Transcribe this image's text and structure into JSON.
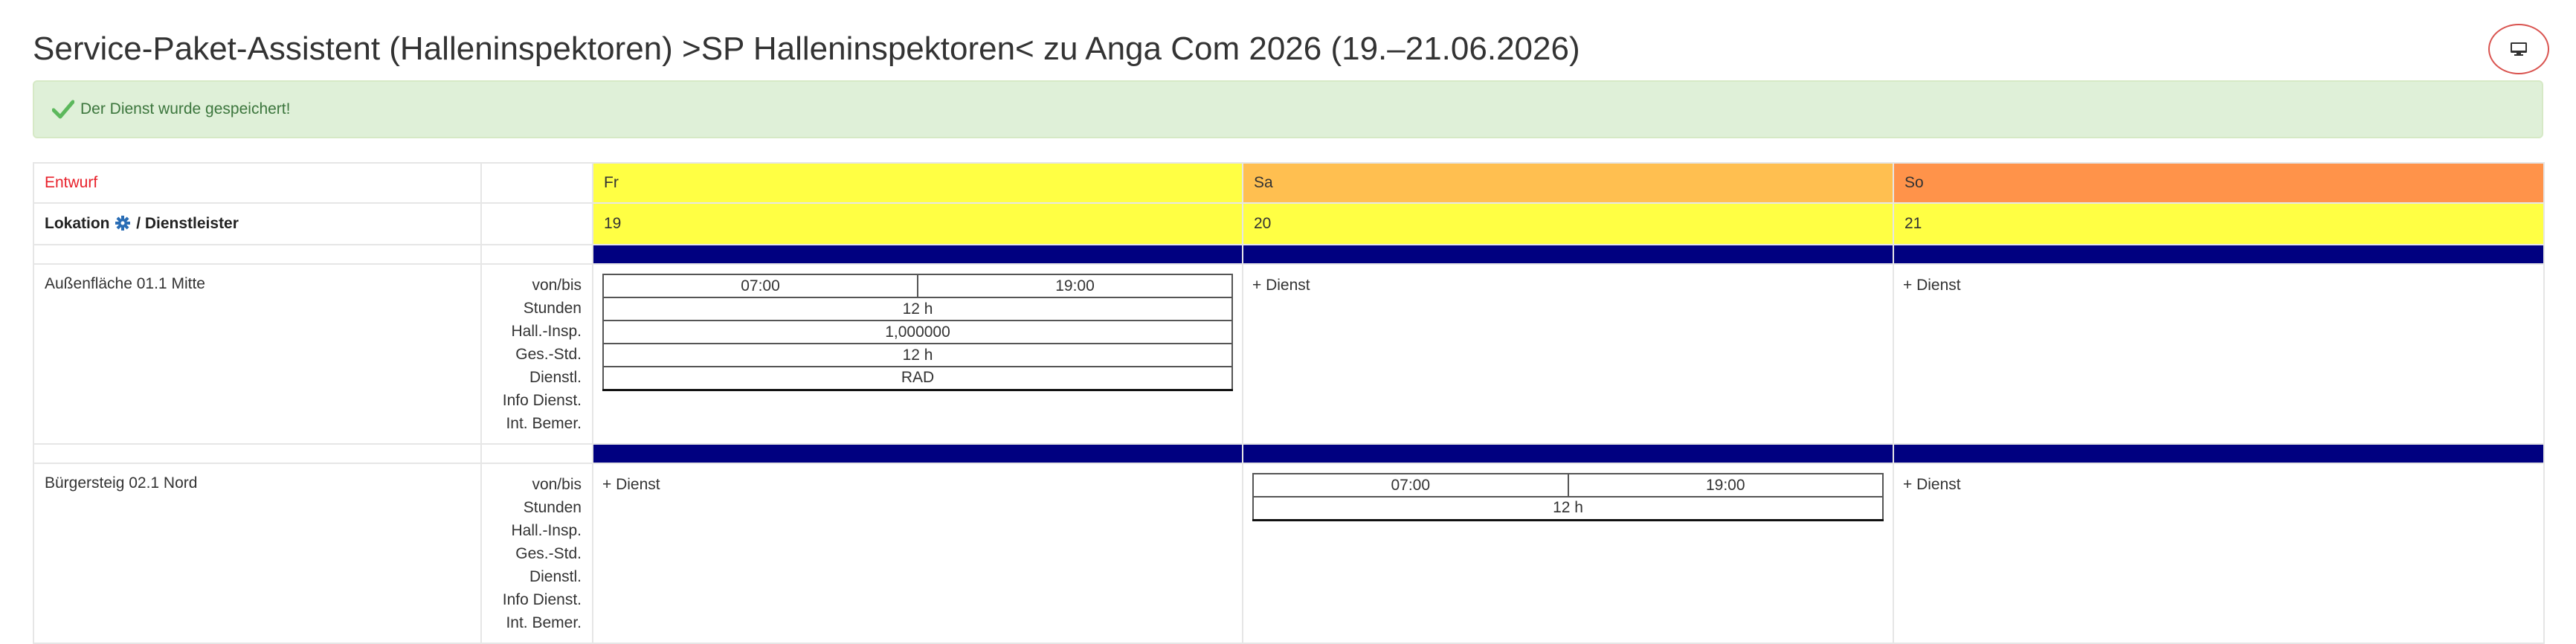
{
  "page": {
    "title": "Service-Paket-Assistent (Halleninspektoren) >SP Halleninspektoren< zu Anga Com 2026 (19.–21.06.2026)",
    "screen_toggle_icon": "monitor-icon"
  },
  "alert": {
    "message": "Der Dienst wurde gespeichert!",
    "icon": "checkmark-icon",
    "color": "#3c763d"
  },
  "grid": {
    "status": "Entwurf",
    "status_color": "#e8212b",
    "location_header_a": "Lokation",
    "location_header_b": "/ Dienstleister",
    "location_header_icon": "gear-icon",
    "days": [
      {
        "name": "Fr",
        "date": "19",
        "color": "#ffff44"
      },
      {
        "name": "Sa",
        "date": "20",
        "color": "#ffbf50"
      },
      {
        "name": "So",
        "date": "21",
        "color": "#ff934a"
      }
    ],
    "field_labels": [
      "von/bis",
      "Stunden",
      "Hall.-Insp.",
      "Ges.-Std.",
      "Dienstl.",
      "Info Dienst.",
      "Int. Bemer."
    ],
    "add_service_label": "+ Dienst",
    "rows": [
      {
        "location": "Außenfläche 01.1 Mitte",
        "service": {
          "from": "07:00",
          "to": "19:00",
          "hours": "12 h",
          "hall_insp": "1,000000",
          "total_hours": "12 h",
          "provider": "RAD"
        }
      },
      {
        "location": "Bürgersteig 02.1 Nord",
        "service": {
          "from": "07:00",
          "to": "19:00",
          "hours": "12 h"
        }
      }
    ]
  }
}
